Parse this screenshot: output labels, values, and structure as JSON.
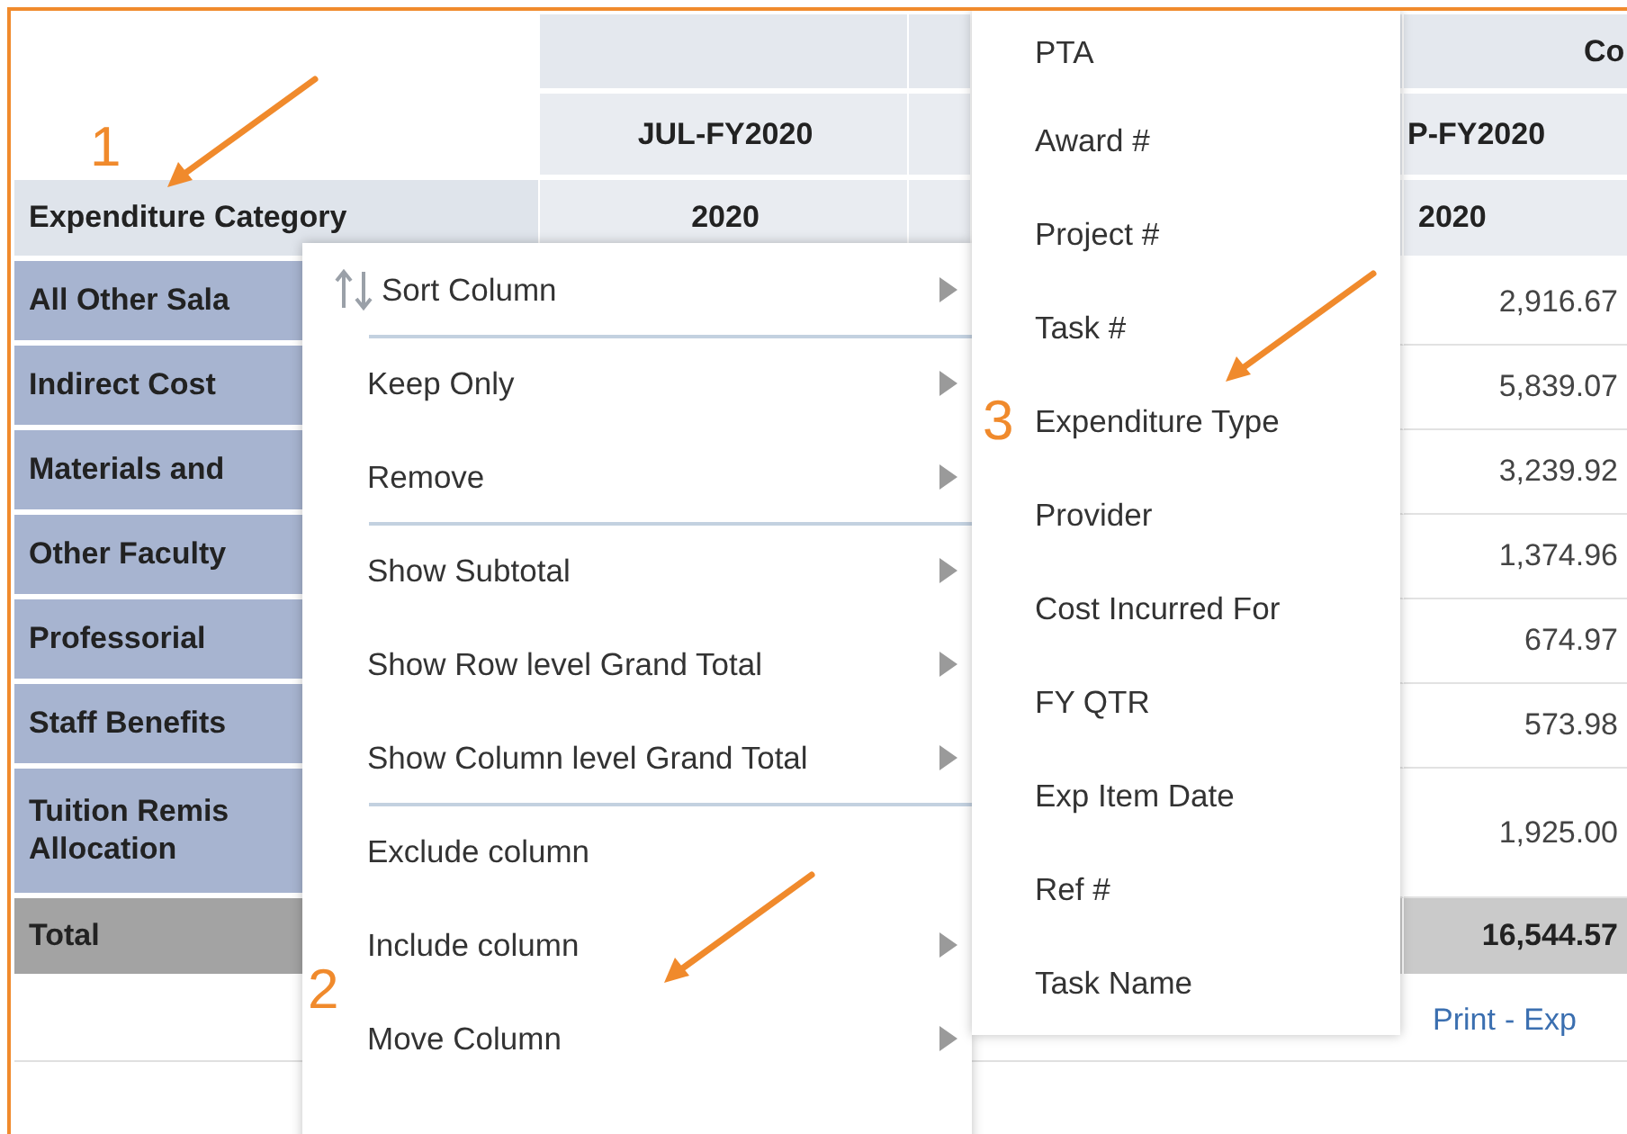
{
  "table": {
    "top_header": "Co",
    "row_header": "Expenditure Category",
    "columns": [
      {
        "period": "JUL-FY2020",
        "year": "2020"
      },
      {
        "period": "P-FY2020",
        "year": "2020"
      }
    ],
    "rows": [
      {
        "label": "All Other Sala",
        "value": "2,916.67"
      },
      {
        "label": "Indirect Cost",
        "value": "5,839.07"
      },
      {
        "label": "Materials and",
        "value": "3,239.92"
      },
      {
        "label": "Other Faculty",
        "value": "1,374.96"
      },
      {
        "label": "Professorial",
        "value": "674.97"
      },
      {
        "label": "Staff Benefits",
        "value": "573.98"
      },
      {
        "label": "Tuition Remis Allocation",
        "value": "1,925.00"
      }
    ],
    "total": {
      "label": "Total",
      "value": "16,544.57"
    },
    "footer": {
      "links": [
        "Print",
        "Exp"
      ],
      "separator": "-"
    }
  },
  "context_menu": {
    "items": [
      {
        "label": "Sort Column",
        "has_submenu": true,
        "divider_after": true
      },
      {
        "label": "Keep Only",
        "has_submenu": true,
        "divider_after": false
      },
      {
        "label": "Remove",
        "has_submenu": true,
        "divider_after": true
      },
      {
        "label": "Show Subtotal",
        "has_submenu": true,
        "divider_after": false
      },
      {
        "label": "Show Row level Grand Total",
        "has_submenu": true,
        "divider_after": false
      },
      {
        "label": "Show Column level Grand Total",
        "has_submenu": true,
        "divider_after": true
      },
      {
        "label": "Exclude column",
        "has_submenu": false,
        "divider_after": false
      },
      {
        "label": "Include column",
        "has_submenu": true,
        "divider_after": false
      },
      {
        "label": "Move Column",
        "has_submenu": true,
        "divider_after": false
      }
    ]
  },
  "submenu": {
    "items": [
      "PTA",
      "Award #",
      "Project #",
      "Task #",
      "Expenditure Type",
      "Provider",
      "Cost Incurred For",
      "FY QTR",
      "Exp Item Date",
      "Ref #",
      "Task Name"
    ]
  },
  "annotations": [
    {
      "number": "1"
    },
    {
      "number": "2"
    },
    {
      "number": "3"
    }
  ]
}
